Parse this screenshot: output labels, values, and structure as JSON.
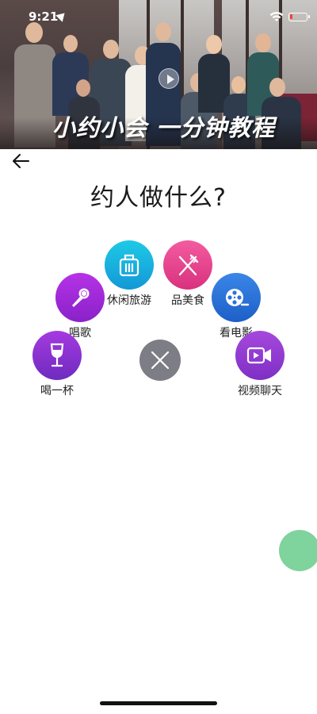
{
  "status_bar": {
    "time": "9:21",
    "battery_color": "#ff3b30",
    "battery_level": 0.15
  },
  "banner": {
    "title": "小约小会 一分钟教程"
  },
  "page": {
    "title": "约人做什么?"
  },
  "activities": [
    {
      "label": "休闲旅游",
      "icon": "luggage-icon",
      "color": "#1aaedf"
    },
    {
      "label": "品美食",
      "icon": "fork-knife-icon",
      "color": "#e6428d"
    },
    {
      "label": "唱歌",
      "icon": "microphone-icon",
      "color": "#a02ad8"
    },
    {
      "label": "看电影",
      "icon": "film-reel-icon",
      "color": "#2b72d8"
    },
    {
      "label": "喝一杯",
      "icon": "wine-glass-icon",
      "color": "#8a33d2"
    },
    {
      "label": "视频聊天",
      "icon": "video-camera-icon",
      "color": "#9340d2"
    }
  ],
  "close_button": {
    "icon": "close-icon",
    "color": "#7d7d86"
  },
  "floating_bubble": {
    "color": "#7fd39c"
  }
}
